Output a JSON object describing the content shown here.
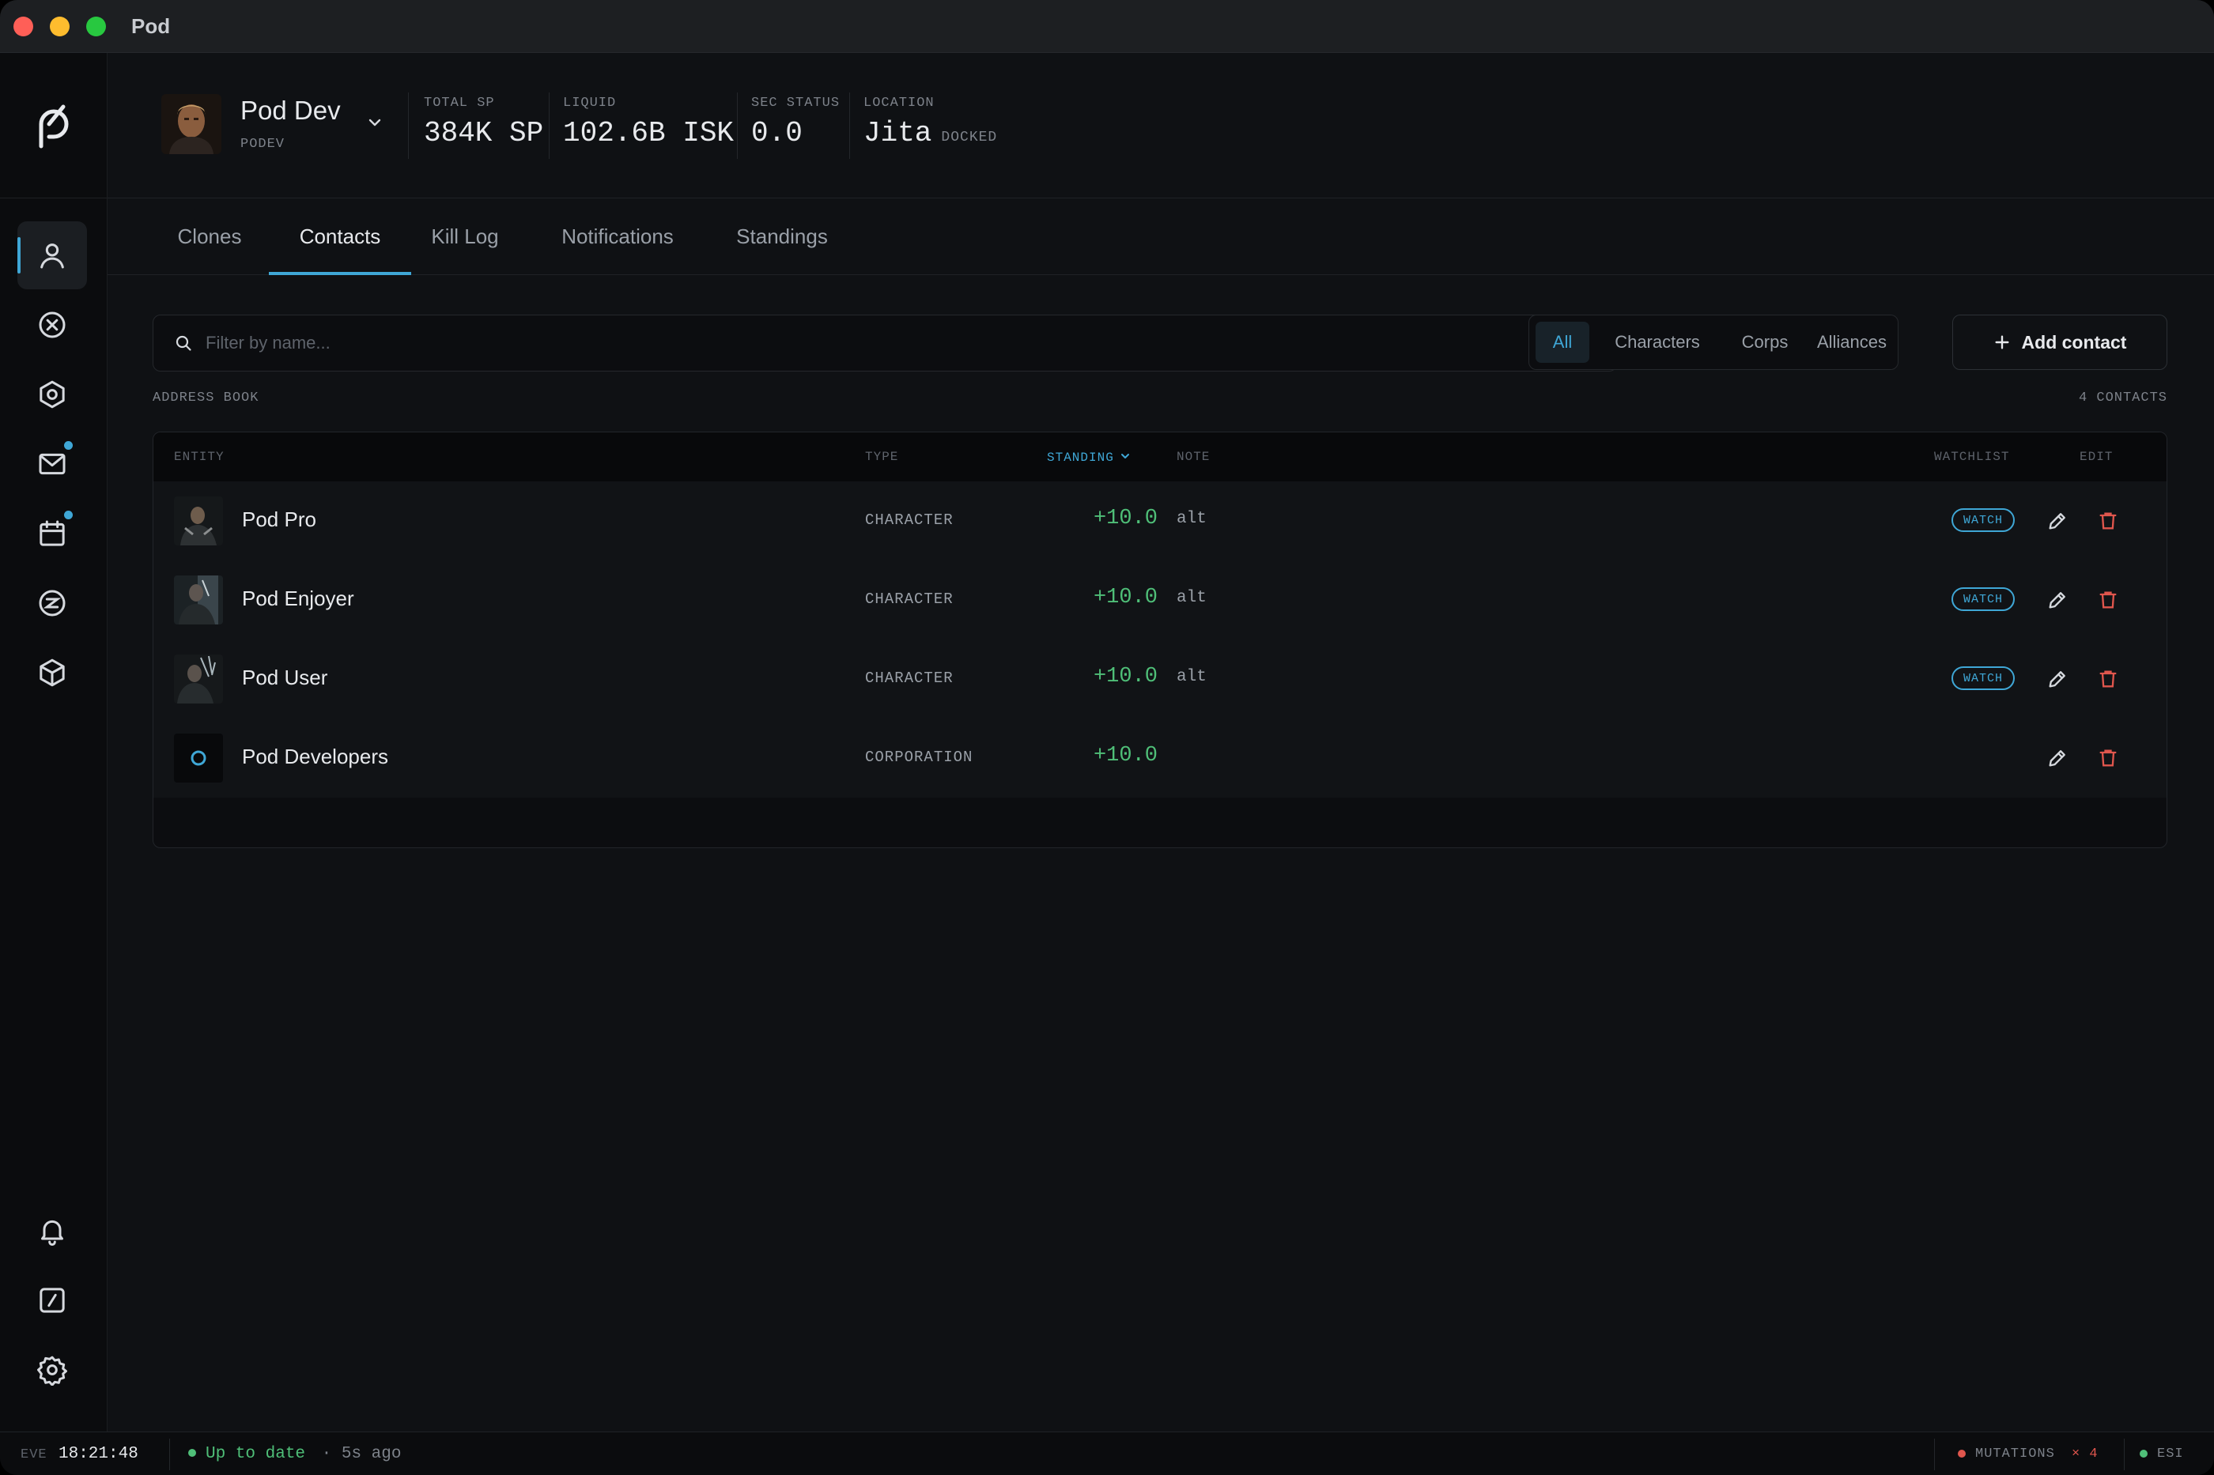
{
  "window": {
    "title": "Pod"
  },
  "sidebar": {
    "items": [
      {
        "icon": "person-icon",
        "active": true
      },
      {
        "icon": "crossed-circle-icon"
      },
      {
        "icon": "hexagon-icon"
      },
      {
        "icon": "mail-icon",
        "badge": true
      },
      {
        "icon": "calendar-icon",
        "badge": true
      },
      {
        "icon": "currency-icon"
      },
      {
        "icon": "cube-icon"
      }
    ],
    "bottom_items": [
      {
        "icon": "bell-icon"
      },
      {
        "icon": "terminal-icon"
      },
      {
        "icon": "gear-icon"
      }
    ]
  },
  "character": {
    "name": "Pod Dev",
    "ticker": "PODEV"
  },
  "stats": {
    "total_sp": {
      "label": "TOTAL SP",
      "value": "384K SP"
    },
    "liquid": {
      "label": "LIQUID",
      "value": "102.6B ISK"
    },
    "sec_status": {
      "label": "SEC STATUS",
      "value": "0.0"
    },
    "location": {
      "label": "LOCATION",
      "value": "Jita",
      "sub": "DOCKED"
    }
  },
  "tabs": [
    {
      "label": "Clones"
    },
    {
      "label": "Contacts",
      "active": true
    },
    {
      "label": "Kill Log"
    },
    {
      "label": "Notifications"
    },
    {
      "label": "Standings"
    }
  ],
  "search": {
    "placeholder": "Filter by name...",
    "value": ""
  },
  "filters": [
    {
      "label": "All",
      "active": true
    },
    {
      "label": "Characters"
    },
    {
      "label": "Corps"
    },
    {
      "label": "Alliances"
    }
  ],
  "add_contact_label": "Add contact",
  "address_book": {
    "label": "ADDRESS BOOK",
    "count_label": "4 CONTACTS",
    "columns": {
      "entity": "ENTITY",
      "type": "TYPE",
      "standing": "STANDING",
      "note": "NOTE",
      "watchlist": "WATCHLIST",
      "edit": "EDIT"
    },
    "rows": [
      {
        "name": "Pod Pro",
        "type": "CHARACTER",
        "standing": "+10.0",
        "note": "alt",
        "watch": "WATCH"
      },
      {
        "name": "Pod Enjoyer",
        "type": "CHARACTER",
        "standing": "+10.0",
        "note": "alt",
        "watch": "WATCH"
      },
      {
        "name": "Pod User",
        "type": "CHARACTER",
        "standing": "+10.0",
        "note": "alt",
        "watch": "WATCH"
      },
      {
        "name": "Pod Developers",
        "type": "CORPORATION",
        "standing": "+10.0",
        "note": "",
        "watch": ""
      }
    ]
  },
  "statusbar": {
    "eve_label": "EVE",
    "time": "18:21:48",
    "sync_status": "Up to date",
    "sync_ago": "· 5s ago",
    "mutations_label": "MUTATIONS",
    "mutations_count": "× 4",
    "esi_label": "ESI"
  },
  "colors": {
    "accent": "#3fa7d6",
    "positive": "#4fbf78",
    "danger": "#e0564d",
    "background": "#0f1114"
  }
}
